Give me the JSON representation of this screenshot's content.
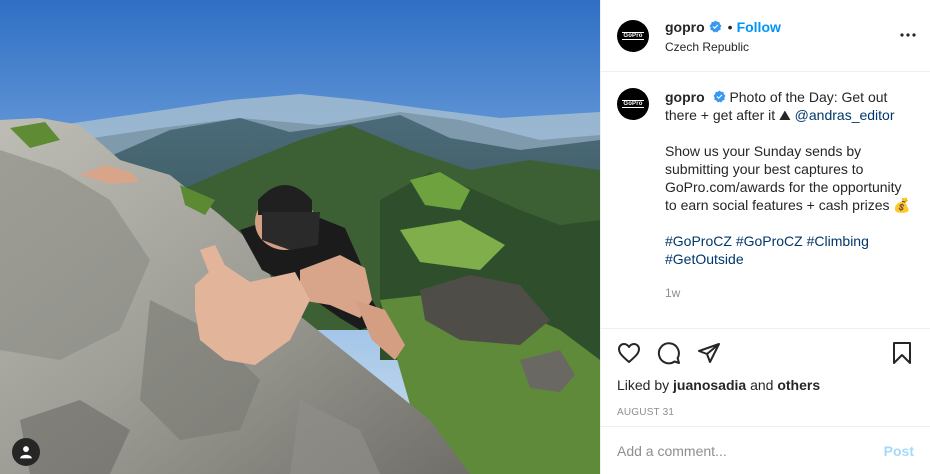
{
  "header": {
    "username": "gopro",
    "separator": "•",
    "follow_label": "Follow",
    "location": "Czech Republic",
    "avatar_text": "GoPro"
  },
  "caption": {
    "username": "gopro",
    "text_1": "Photo of the Day: Get out there + get after it",
    "mountain_emoji": "⛰",
    "mention": "@andras_editor",
    "paragraph_2": "Show us your Sunday sends by submitting your best captures to GoPro.com/awards for the opportunity to earn social features + cash prizes",
    "money_emoji": "💰",
    "hashtags": [
      "#GoProCZ",
      "#GoProCZ",
      "#Climbing",
      "#GetOutside"
    ],
    "time_ago": "1w"
  },
  "likes": {
    "prefix": "Liked by",
    "user": "juanosadia",
    "conj": "and",
    "others": "others"
  },
  "date": "AUGUST 31",
  "add_comment": {
    "placeholder": "Add a comment...",
    "post_label": "Post"
  },
  "icons": {
    "like": "heart-icon",
    "comment": "comment-icon",
    "share": "share-icon",
    "save": "bookmark-icon",
    "more": "more-options-icon",
    "tag": "user-tag-icon",
    "verified": "verified-badge-icon"
  },
  "colors": {
    "accent": "#0095f6",
    "mention": "#00376b",
    "muted": "#8e8e8e",
    "border": "#efefef"
  }
}
